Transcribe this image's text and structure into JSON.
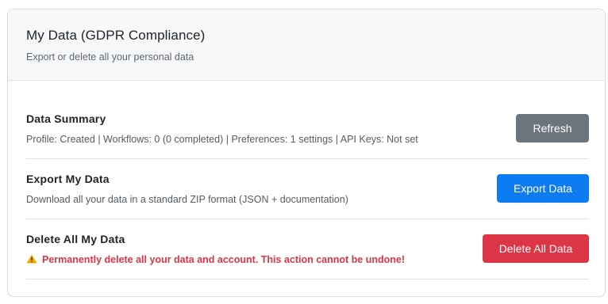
{
  "header": {
    "title": "My Data (GDPR Compliance)",
    "subtitle": "Export or delete all your personal data"
  },
  "sections": {
    "summary": {
      "title": "Data Summary",
      "description": "Profile: Created | Workflows: 0 (0 completed) | Preferences: 1 settings | API Keys: Not set",
      "button_label": "Refresh"
    },
    "export": {
      "title": "Export My Data",
      "description": "Download all your data in a standard ZIP format (JSON + documentation)",
      "button_label": "Export Data"
    },
    "delete": {
      "title": "Delete All My Data",
      "warning_icon": "warning-icon",
      "warning": "Permanently delete all your data and account. This action cannot be undone!",
      "button_label": "Delete All Data"
    }
  },
  "colors": {
    "secondary": "#6c757d",
    "primary": "#0d7cf2",
    "danger": "#dc3545",
    "warning_icon": "#f0a500"
  }
}
